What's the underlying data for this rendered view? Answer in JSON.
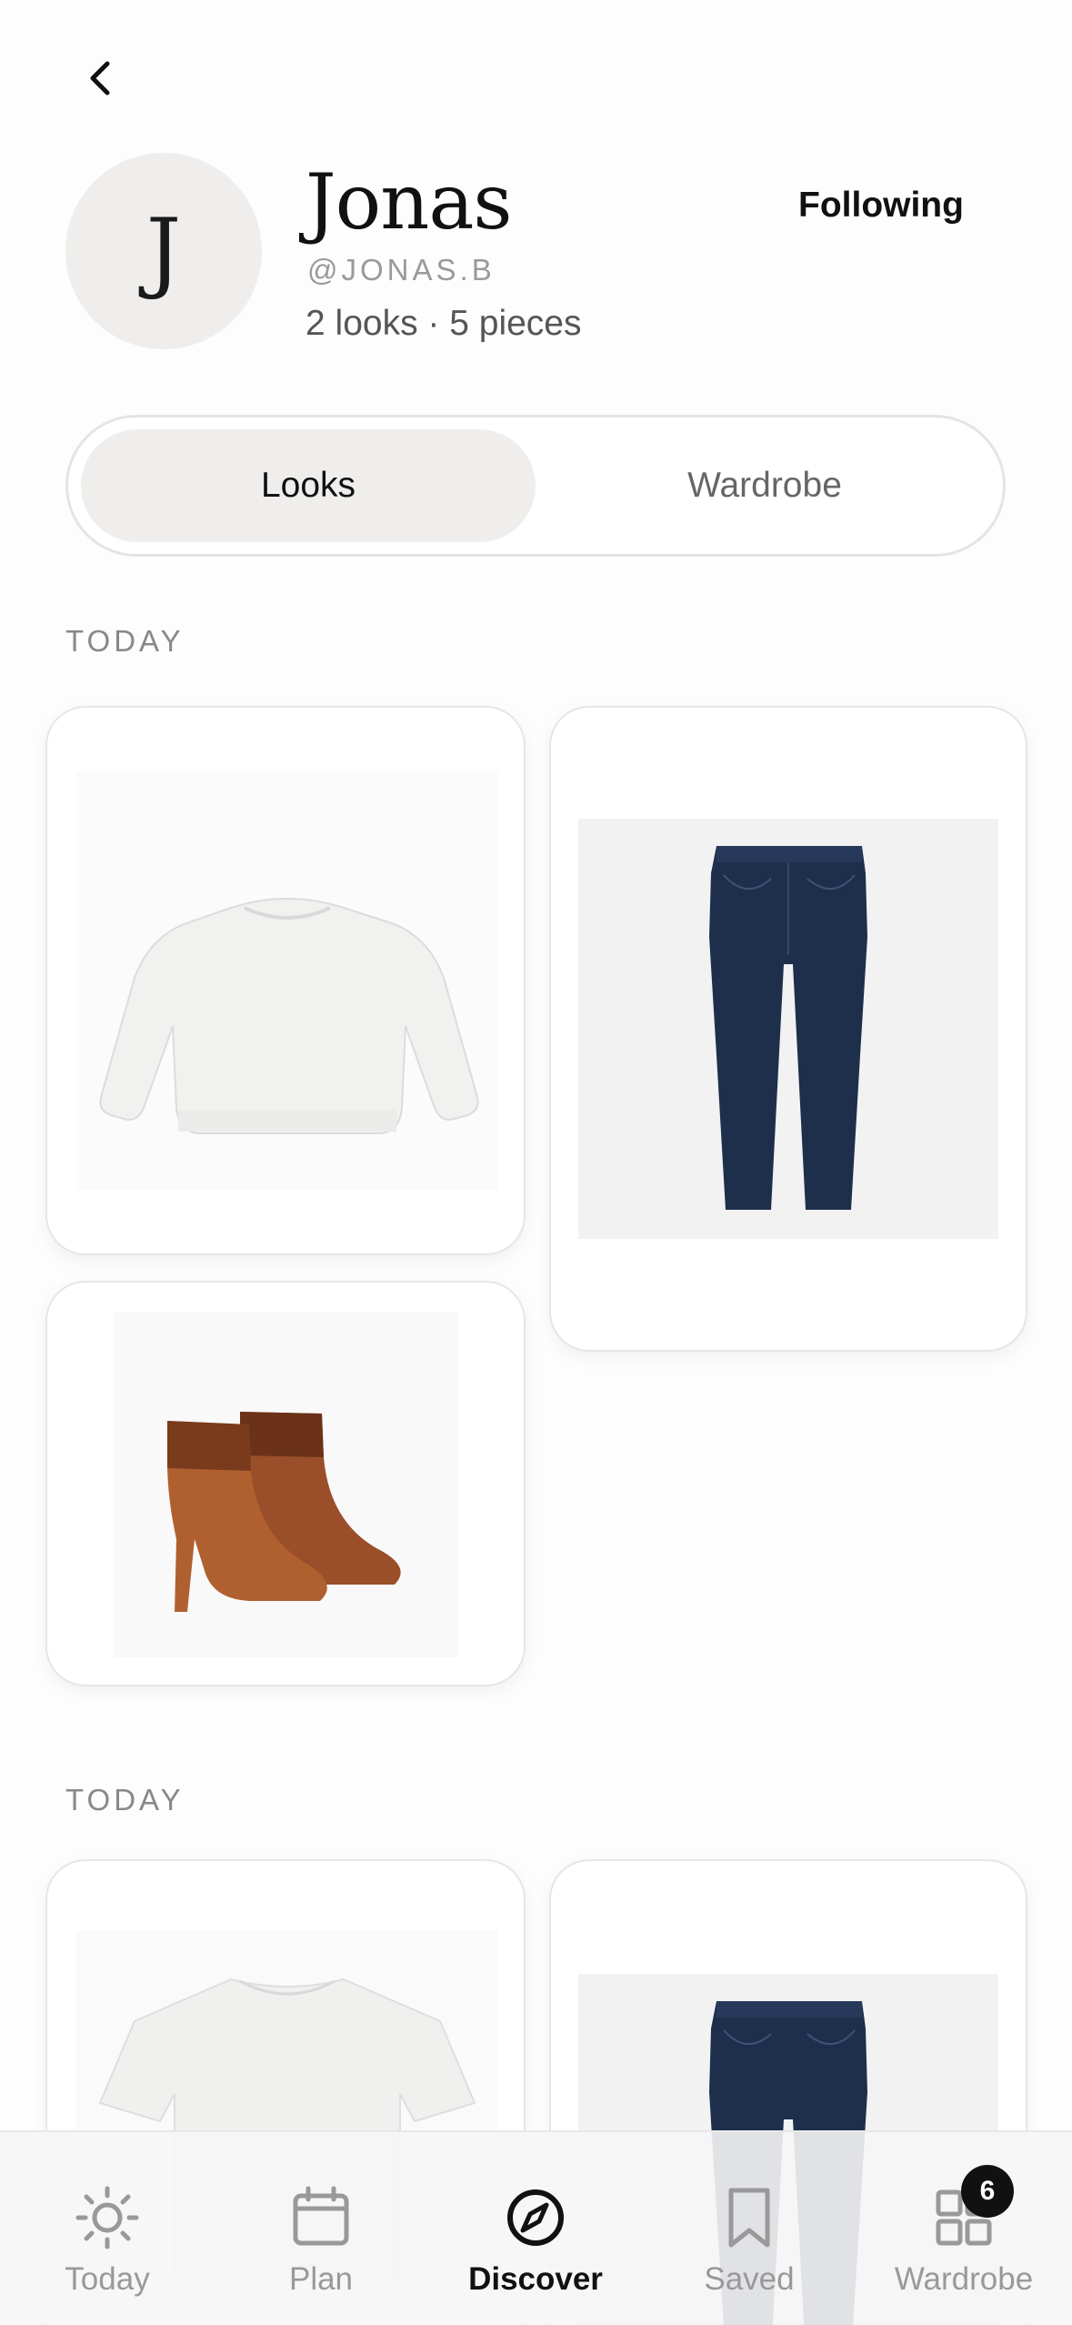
{
  "profile": {
    "initial": "J",
    "name": "Jonas",
    "handle": "@JONAS.B",
    "counts": "2 looks · 5 pieces",
    "follow_label": "Following"
  },
  "segment": {
    "tabs": [
      "Looks",
      "Wardrobe"
    ],
    "active": "Looks"
  },
  "sections": [
    {
      "label": "TODAY",
      "items": [
        {
          "name": "sweater",
          "description": "white crew-neck sweater"
        },
        {
          "name": "jeans",
          "description": "dark blue jeans"
        },
        {
          "name": "boots",
          "description": "brown heeled ankle boots"
        }
      ]
    },
    {
      "label": "TODAY",
      "items": [
        {
          "name": "t-shirt",
          "description": "white t-shirt"
        },
        {
          "name": "jeans",
          "description": "dark blue jeans"
        }
      ]
    }
  ],
  "tabbar": {
    "items": [
      {
        "label": "Today",
        "icon": "sun-icon"
      },
      {
        "label": "Plan",
        "icon": "calendar-icon"
      },
      {
        "label": "Discover",
        "icon": "compass-icon",
        "active": true
      },
      {
        "label": "Saved",
        "icon": "bookmark-icon"
      },
      {
        "label": "Wardrobe",
        "icon": "grid-icon"
      }
    ],
    "wardrobe_badge": "6"
  },
  "colors": {
    "accent": "#111111",
    "denim": "#1e2f4c",
    "boot_leather": "#a9582e",
    "muted_text": "#999999"
  }
}
